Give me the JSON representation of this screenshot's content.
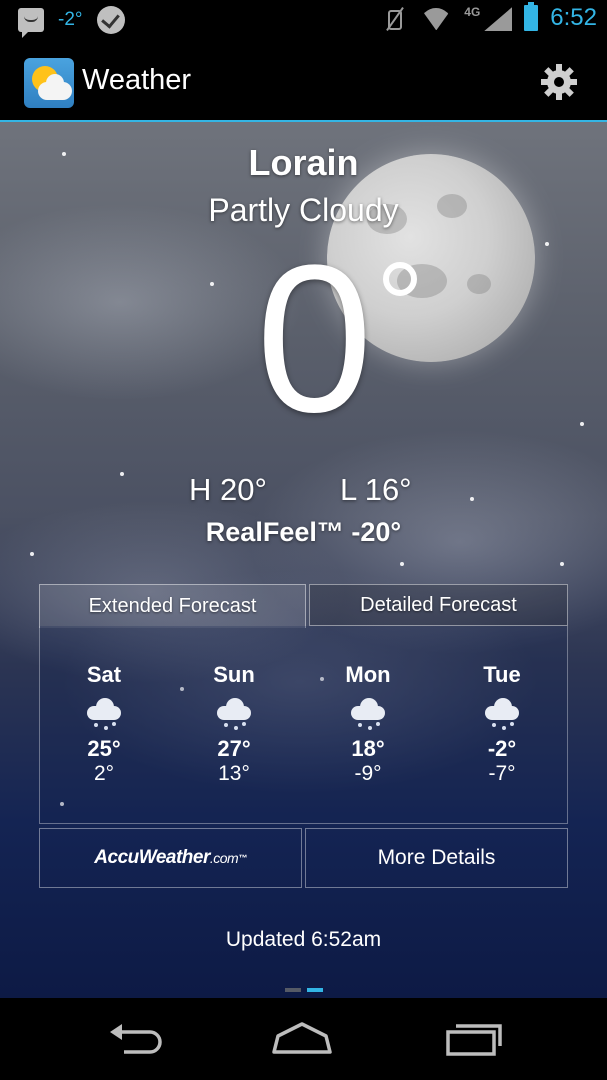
{
  "status_bar": {
    "temperature": "-2°",
    "time": "6:52",
    "network": "4G",
    "icons": [
      "message-icon",
      "temperature-icon",
      "check-icon",
      "mute-icon",
      "wifi-icon",
      "signal-icon",
      "battery-icon"
    ]
  },
  "app_bar": {
    "title": "Weather",
    "icons": [
      "weather-app-icon",
      "settings-gear-icon"
    ]
  },
  "current": {
    "city": "Lorain",
    "condition": "Partly Cloudy",
    "temperature": "0",
    "high": "H 20°",
    "low": "L 16°",
    "realfeel": "RealFeel™ -20°"
  },
  "tabs": [
    {
      "label": "Extended Forecast",
      "selected": true
    },
    {
      "label": "Detailed Forecast",
      "selected": false
    }
  ],
  "forecast": [
    {
      "day": "Sat",
      "high": "25°",
      "low": "2°",
      "icon": "snow-cloud-icon"
    },
    {
      "day": "Sun",
      "high": "27°",
      "low": "13°",
      "icon": "snow-cloud-icon"
    },
    {
      "day": "Mon",
      "high": "18°",
      "low": "-9°",
      "icon": "snow-cloud-icon"
    },
    {
      "day": "Tue",
      "high": "-2°",
      "low": "-7°",
      "icon": "snow-cloud-icon"
    }
  ],
  "buttons": {
    "accuweather_main": "AccuWeather",
    "accuweather_suffix": ".com",
    "accuweather_tm": "™",
    "more_details": "More Details"
  },
  "updated": "Updated 6:52am",
  "pager": {
    "pages": 2,
    "active": 2
  },
  "colors": {
    "accent": "#33b5e5",
    "status_icon": "#9a9a9a",
    "sky_bottom": "#0d1a45"
  },
  "nav_bar": {
    "icons": [
      "back-icon",
      "home-icon",
      "recent-apps-icon"
    ]
  }
}
